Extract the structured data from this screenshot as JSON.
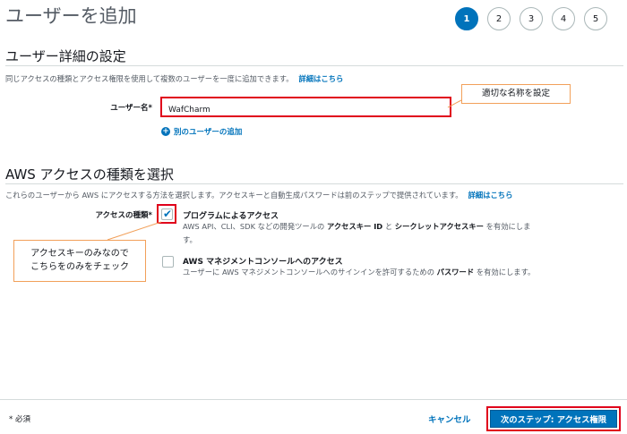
{
  "header": {
    "title": "ユーザーを追加",
    "steps": [
      "1",
      "2",
      "3",
      "4",
      "5"
    ]
  },
  "details": {
    "section_title": "ユーザー詳細の設定",
    "description": "同じアクセスの種類とアクセス権限を使用して複数のユーザーを一度に追加できます。",
    "learn_more": "詳細はこちら",
    "username_label": "ユーザー名*",
    "username_value": "WafCharm",
    "add_user_link": "別のユーザーの追加"
  },
  "access": {
    "section_title": "AWS アクセスの種類を選択",
    "description": "これらのユーザーから AWS にアクセスする方法を選択します。アクセスキーと自動生成パスワードは前のステップで提供されています。",
    "learn_more": "詳細はこちら",
    "type_label": "アクセスの種類*",
    "option1": {
      "title": "プログラムによるアクセス",
      "desc_a": "AWS API、CLI、SDK などの開発ツールの",
      "desc_b": "アクセスキー ID",
      "desc_c": "と",
      "desc_d": "シークレットアクセスキー",
      "desc_e": "を有効にします。",
      "checked": true
    },
    "option2": {
      "title": "AWS マネジメントコンソールへのアクセス",
      "desc_a": "ユーザーに AWS マネジメントコンソールへのサインインを許可するための",
      "desc_b": "パスワード",
      "desc_c": "を有効にします。",
      "checked": false
    }
  },
  "annotations": {
    "callout1": "適切な名称を設定",
    "callout2_line1": "アクセスキーのみなので",
    "callout2_line2": "こちらをのみをチェック"
  },
  "footer": {
    "required": "* 必須",
    "cancel": "キャンセル",
    "next": "次のステップ: アクセス権限"
  },
  "colors": {
    "accent": "#0073bb",
    "highlight": "#e0001b",
    "callout_border": "#f2a05a"
  }
}
